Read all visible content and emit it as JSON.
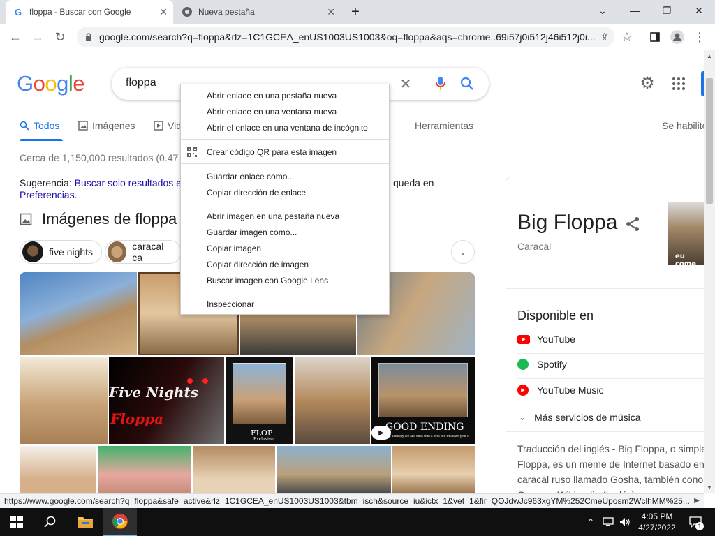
{
  "browser": {
    "tabs": [
      {
        "title": "floppa - Buscar con Google",
        "active": true,
        "favicon": "google-g-icon"
      },
      {
        "title": "Nueva pestaña",
        "active": false,
        "favicon": "chrome-icon"
      }
    ],
    "new_tab_glyph": "+",
    "window_controls": {
      "minimize": "—",
      "maximize": "❐",
      "close": "✕",
      "tab_search": "⌄"
    },
    "url": "google.com/search?q=floppa&rlz=1C1GCEA_enUS1003US1003&oq=floppa&aqs=chrome..69i57j0i512j46i512j0i..."
  },
  "google": {
    "logo": [
      "G",
      "o",
      "o",
      "g",
      "l",
      "e"
    ],
    "logo_colors": [
      "#4285f4",
      "#ea4335",
      "#fbbc05",
      "#4285f4",
      "#34a853",
      "#ea4335"
    ],
    "query": "floppa",
    "tabs": {
      "all": "Todos",
      "images": "Imágenes",
      "videos": "Vid",
      "tools": "Herramientas",
      "safe": "Se habilitó"
    },
    "results_count": "Cerca de 1,150,000 resultados (0.47",
    "suggestion": {
      "prefix": "Sugerencia:",
      "link1": "Buscar solo resultados e",
      "tail": "queda en",
      "link2": "Preferencias."
    },
    "images_heading": "Imágenes de floppa",
    "chips": [
      "five nights",
      "caracal ca"
    ],
    "image_captions": {
      "five_nights": "Five Nights",
      "floppa": "Floppa",
      "flop": "FLOP",
      "flop_sub": "Exclusive",
      "good_ending": "GOOD ENDING",
      "good_sub": "The unhappy life and ends with a with you will have your thats"
    }
  },
  "knowledge_panel": {
    "title": "Big Floppa",
    "subtitle": "Caracal",
    "thumb_caption": "eu come",
    "available_heading": "Disponible en",
    "services": [
      {
        "name": "YouTube",
        "icon": "youtube-icon",
        "color": "#ff0000"
      },
      {
        "name": "Spotify",
        "icon": "spotify-icon",
        "color": "#1db954"
      },
      {
        "name": "YouTube Music",
        "icon": "youtube-music-icon",
        "color": "#ff0000"
      }
    ],
    "more_services": "Más servicios de música",
    "description": [
      "Traducción del inglés - Big Floppa, o simple",
      "Floppa, es un meme de Internet basado en",
      "caracal ruso llamado Gosha, también cono",
      "Gregory. Wikipedia (Inglés)"
    ]
  },
  "context_menu": {
    "group1": [
      "Abrir enlace en una pestaña nueva",
      "Abrir enlace en una ventana nueva",
      "Abrir el enlace en una ventana de incógnito"
    ],
    "qr": "Crear código QR para esta imagen",
    "group3": [
      "Guardar enlace como...",
      "Copiar dirección de enlace"
    ],
    "group4": [
      "Abrir imagen en una pestaña nueva",
      "Guardar imagen como...",
      "Copiar imagen",
      "Copiar dirección de imagen",
      "Buscar imagen con Google Lens"
    ],
    "inspect": "Inspeccionar"
  },
  "status_url": "https://www.google.com/search?q=floppa&safe=active&rlz=1C1GCEA_enUS1003US1003&tbm=isch&source=iu&ictx=1&vet=1&fir=QOJdwJc963xgYM%252CmeUposm2WclhMM%25...",
  "taskbar": {
    "time": "4:05 PM",
    "date": "4/27/2022",
    "notification_count": "1"
  }
}
